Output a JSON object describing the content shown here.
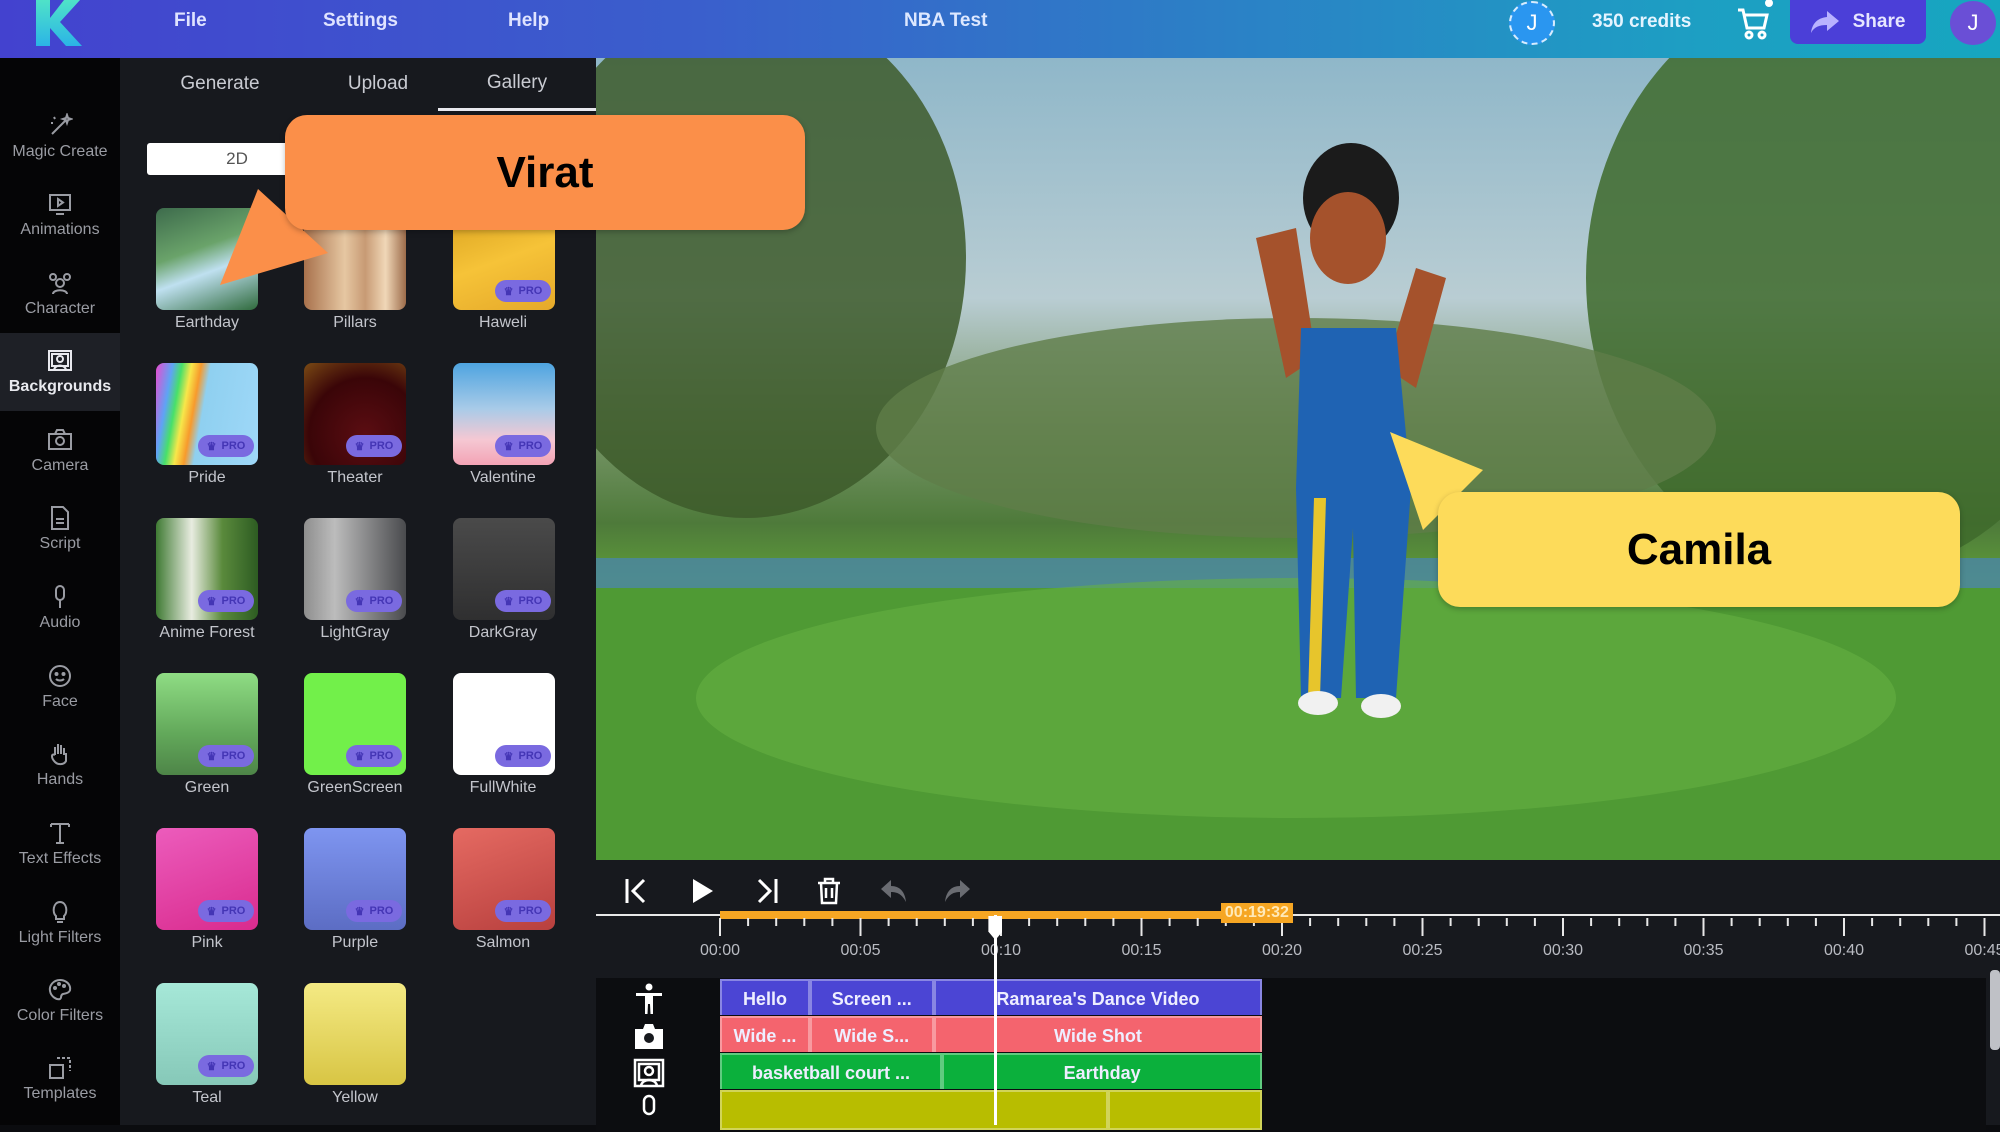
{
  "topbar": {
    "menu": [
      "File",
      "Settings",
      "Help"
    ],
    "title": "NBA Test",
    "user_initial": "J",
    "credits": "350 credits",
    "share_label": "Share",
    "colors": {
      "start": "#4342cf",
      "end": "#16a6c0",
      "share": "#4b3fd8"
    }
  },
  "sidebar": {
    "items": [
      {
        "label": "Magic Create",
        "icon": "magic-wand-icon"
      },
      {
        "label": "Animations",
        "icon": "animation-play-icon"
      },
      {
        "label": "Character",
        "icon": "characters-icon"
      },
      {
        "label": "Backgrounds",
        "icon": "background-icon",
        "active": true
      },
      {
        "label": "Camera",
        "icon": "camera-icon"
      },
      {
        "label": "Script",
        "icon": "script-file-icon"
      },
      {
        "label": "Audio",
        "icon": "microphone-icon"
      },
      {
        "label": "Face",
        "icon": "face-icon"
      },
      {
        "label": "Hands",
        "icon": "hand-icon"
      },
      {
        "label": "Text Effects",
        "icon": "text-icon"
      },
      {
        "label": "Light Filters",
        "icon": "light-bulb-icon"
      },
      {
        "label": "Color Filters",
        "icon": "palette-icon"
      },
      {
        "label": "Templates",
        "icon": "templates-icon"
      }
    ]
  },
  "panel": {
    "tabs": [
      "Generate",
      "Upload",
      "Gallery"
    ],
    "active_tab": "Gallery",
    "segment": "2D",
    "pro_label": "PRO",
    "backgrounds": [
      {
        "name": "Earthday",
        "pro": false
      },
      {
        "name": "Pillars",
        "pro": false
      },
      {
        "name": "Haweli",
        "pro": true
      },
      {
        "name": "Pride",
        "pro": true
      },
      {
        "name": "Theater",
        "pro": true
      },
      {
        "name": "Valentine",
        "pro": true
      },
      {
        "name": "Anime Forest",
        "pro": true
      },
      {
        "name": "LightGray",
        "pro": true
      },
      {
        "name": "DarkGray",
        "pro": true
      },
      {
        "name": "Green",
        "pro": true
      },
      {
        "name": "GreenScreen",
        "pro": true
      },
      {
        "name": "FullWhite",
        "pro": true
      },
      {
        "name": "Pink",
        "pro": true
      },
      {
        "name": "Purple",
        "pro": true
      },
      {
        "name": "Salmon",
        "pro": true
      },
      {
        "name": "Teal",
        "pro": true
      },
      {
        "name": "Yellow",
        "pro": false
      }
    ]
  },
  "annotations": {
    "virat": {
      "label": "Virat",
      "color": "#fb8f49"
    },
    "camila": {
      "label": "Camila",
      "color": "#fddb5a"
    }
  },
  "timeline": {
    "end_marker": "00:19:32",
    "ticks": [
      "00:00",
      "00:05",
      "00:10",
      "00:15",
      "00:20",
      "00:25",
      "00:30",
      "00:35",
      "00:40",
      "00:45"
    ],
    "playhead_seconds": 9.8,
    "tracks": [
      {
        "type": "animation",
        "icon": "person-icon",
        "color": "#4b45d4",
        "clips": [
          {
            "label": "Hello"
          },
          {
            "label": "Screen ..."
          },
          {
            "label": "Ramarea's Dance Video"
          }
        ]
      },
      {
        "type": "camera",
        "icon": "camera-icon",
        "color": "#f4646e",
        "clips": [
          {
            "label": "Wide ..."
          },
          {
            "label": "Wide S..."
          },
          {
            "label": "Wide Shot"
          }
        ]
      },
      {
        "type": "background",
        "icon": "background-icon",
        "color": "#0bb03c",
        "clips": [
          {
            "label": "basketball court ..."
          },
          {
            "label": "Earthday"
          }
        ]
      },
      {
        "type": "audio",
        "icon": "microphone-icon",
        "color": "#b8bd00",
        "clips": [
          {
            "label": ""
          },
          {
            "label": ""
          }
        ]
      }
    ]
  }
}
